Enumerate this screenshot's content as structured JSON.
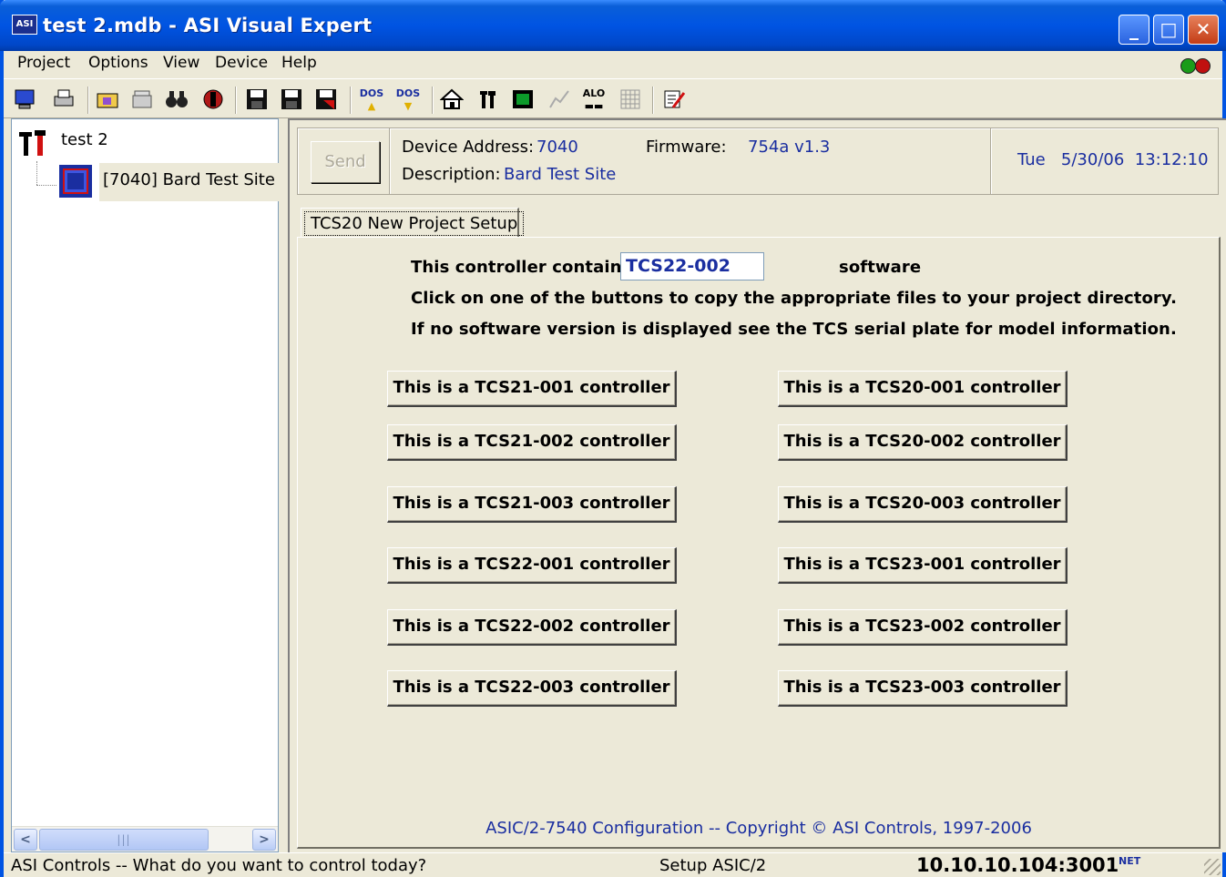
{
  "window": {
    "title": "test 2.mdb - ASI Visual Expert",
    "app_icon_text": "ASI",
    "min_glyph": "_",
    "max_glyph": "□",
    "close_glyph": "✕"
  },
  "menu": {
    "items": [
      "Project",
      "Options",
      "View",
      "Device",
      "Help"
    ]
  },
  "status_lights": {
    "green": "#1a9c1a",
    "red": "#c01010"
  },
  "toolbar": {
    "icons": [
      "monitor-icon",
      "printer-icon",
      "folder-icon",
      "phone-icon",
      "binoculars-icon",
      "record-icon",
      "save-icon",
      "save-as-icon",
      "save-all-icon",
      "dos-up-icon",
      "dos-down-icon",
      "home-icon",
      "tools-icon",
      "window-icon",
      "graph-icon",
      "alo-icon",
      "grid-icon",
      "edit-icon"
    ],
    "dos_label": "DOS",
    "alo_label": "ALO"
  },
  "tree": {
    "root_label": "test 2",
    "child_label": "[7040] Bard Test Site"
  },
  "header": {
    "send_label": "Send",
    "device_address_label": "Device Address:",
    "device_address_value": "7040",
    "firmware_label": "Firmware:",
    "firmware_value": "754a v1.3",
    "description_label": "Description:",
    "description_value": "Bard Test Site",
    "datetime": "Tue   5/30/06  13:12:10"
  },
  "tab": {
    "label": "TCS20 New Project Setup"
  },
  "setup": {
    "contains_label": "This controller contains",
    "software_value": "TCS22-002",
    "software_label": "software",
    "instruction_1": "Click on one of the buttons to copy the appropriate files to your project directory.",
    "instruction_2": "If no software version is displayed see the TCS serial plate for model information.",
    "left_buttons": [
      "This is a TCS21-001 controller",
      "This is a TCS21-002 controller",
      "This is a TCS21-003 controller",
      "This is a TCS22-001 controller",
      "This is a TCS22-002 controller",
      "This is a TCS22-003 controller"
    ],
    "right_buttons": [
      "This is a TCS20-001 controller",
      "This is a TCS20-002 controller",
      "This is a TCS20-003 controller",
      "This is a TCS23-001 controller",
      "This is a TCS23-002 controller",
      "This is a TCS23-003 controller"
    ],
    "copyright": "ASIC/2-7540 Configuration -- Copyright © ASI Controls, 1997-2006"
  },
  "statusbar": {
    "message": "ASI Controls -- What do you want to control today?",
    "mode": "Setup ASIC/2",
    "address": "10.10.10.104:3001",
    "net_label": "NET"
  },
  "colors": {
    "titlebar": "#0054e3",
    "link_blue": "#1a2ea0",
    "face": "#ece9d8"
  }
}
